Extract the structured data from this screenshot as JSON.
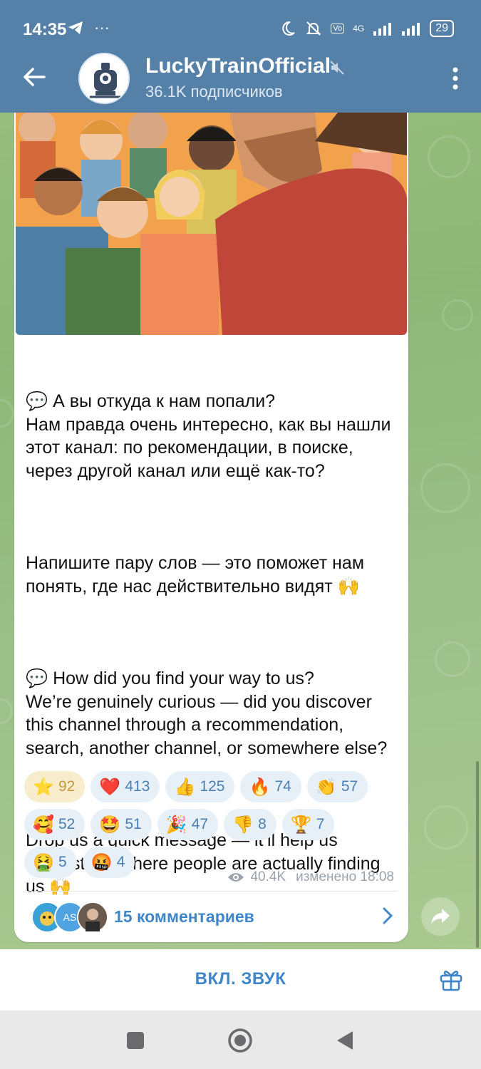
{
  "status": {
    "time": "14:35",
    "battery": "29",
    "network": "4G"
  },
  "channel": {
    "title": "LuckyTrainOfficial",
    "subtitle": "36.1K подписчиков"
  },
  "message": {
    "paragraphs": [
      "💬 А вы откуда к нам попали?\nНам правда очень интересно, как вы нашли этот канал: по рекомендации, в поиске, через другой канал или ещё как-то?",
      "Напишите пару слов — это поможет нам понять, где нас действительно видят 🙌",
      "💬 How did you find your way to us?\nWe’re genuinely curious — did you discover this channel through a recommendation, search, another channel, or somewhere else?",
      "Drop us a quick message — it’ll help us understand where people are actually finding us 🙌"
    ],
    "reactions": [
      {
        "emoji": "⭐",
        "count": "92",
        "active": true,
        "icon": "star-reaction-icon"
      },
      {
        "emoji": "❤️",
        "count": "413",
        "icon": "heart-icon"
      },
      {
        "emoji": "👍",
        "count": "125",
        "icon": "thumbs-up-icon"
      },
      {
        "emoji": "🔥",
        "count": "74",
        "icon": "fire-icon"
      },
      {
        "emoji": "👏",
        "count": "57",
        "icon": "clap-icon"
      },
      {
        "emoji": "🥰",
        "count": "52",
        "icon": "love-face-icon"
      },
      {
        "emoji": "🤩",
        "count": "51",
        "icon": "star-eyes-icon"
      },
      {
        "emoji": "🎉",
        "count": "47",
        "icon": "party-popper-icon"
      },
      {
        "emoji": "👎",
        "count": "8",
        "icon": "thumbs-down-icon"
      },
      {
        "emoji": "🏆",
        "count": "7",
        "icon": "trophy-icon"
      },
      {
        "emoji": "🤮",
        "count": "5",
        "icon": "vomit-face-icon"
      },
      {
        "emoji": "🤬",
        "count": "4",
        "icon": "cursing-face-icon"
      }
    ],
    "views": "40.4K",
    "edited": "изменено 18:08",
    "comments_label": "15 комментариев",
    "comment_avatar_initials": "AS"
  },
  "bottom": {
    "sound_label": "ВКЛ. ЗВУК"
  },
  "colors": {
    "header": "#5580a8",
    "accent": "#3e86c9",
    "reaction_bg": "#e8f0f7"
  }
}
